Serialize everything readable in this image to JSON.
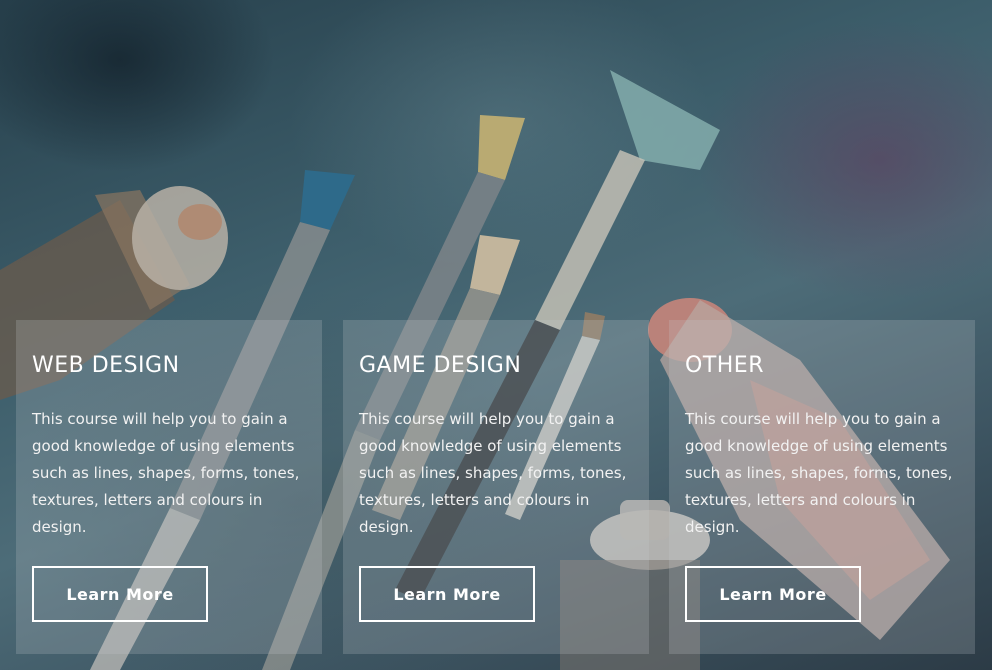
{
  "cards": [
    {
      "title": "WEB DESIGN",
      "description": "This course will help you to gain a good knowledge of using elements such as lines, shapes, forms, tones, textures, letters and colours in design.",
      "button_label": "Learn More"
    },
    {
      "title": "GAME DESIGN",
      "description": "This course will help you to gain a good knowledge of using elements such as lines, shapes, forms, tones, textures, letters and colours in design.",
      "button_label": "Learn More"
    },
    {
      "title": "OTHER",
      "description": "This course will help you to gain a good knowledge of using elements such as lines, shapes, forms, tones, textures, letters and colours in design.",
      "button_label": "Learn More"
    }
  ],
  "colors": {
    "card_overlay": "#c8cdd2",
    "text": "#ffffff",
    "background": "#3d5e6b"
  }
}
